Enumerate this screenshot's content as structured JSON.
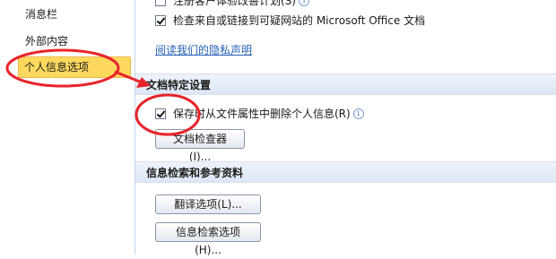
{
  "nav": {
    "items": [
      {
        "label": "消息栏"
      },
      {
        "label": "外部内容"
      },
      {
        "label": "个人信息选项"
      }
    ]
  },
  "main": {
    "top_cut_label": "注册客户体验改善计划(S)",
    "checkbox_check_suspicious": "检查来自或链接到可疑网站的 Microsoft Office 文档",
    "privacy_link": "阅读我们的隐私声明",
    "section_doc_specific": "文档特定设置",
    "checkbox_remove_personal": "保存时从文件属性中删除个人信息(R)",
    "doc_inspector_button": "文档检查器(I)...",
    "section_research": "信息检索和参考资料",
    "translation_button": "翻译选项(L)...",
    "research_button": "信息检索选项(H)..."
  },
  "colors": {
    "selected_nav_bg": "#ffd95e",
    "annotation_red": "#e8232a",
    "link_blue": "#2861b7"
  }
}
